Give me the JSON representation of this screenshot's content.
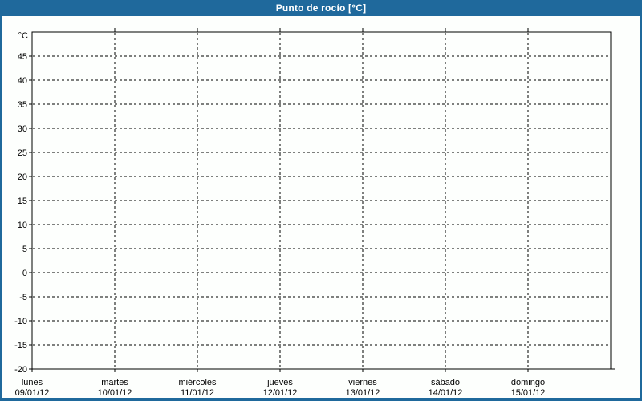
{
  "window": {
    "background": "#fdfffd",
    "border_color": "#1f699c"
  },
  "title_bar": {
    "label": "Punto de rocío [°C]",
    "background": "#1f699c",
    "text_color": "#ffffff"
  },
  "chart_data": {
    "type": "line",
    "title": "Punto de rocío [°C]",
    "unit_label": "°C",
    "ylim": [
      -20,
      50
    ],
    "ytick_step": 5,
    "yticks": [
      45,
      40,
      35,
      30,
      25,
      20,
      15,
      10,
      5,
      0,
      -5,
      -10,
      -15,
      -20
    ],
    "x_categories": [
      {
        "day": "lunes",
        "date": "09/01/12"
      },
      {
        "day": "martes",
        "date": "10/01/12"
      },
      {
        "day": "miércoles",
        "date": "11/01/12"
      },
      {
        "day": "jueves",
        "date": "12/01/12"
      },
      {
        "day": "viernes",
        "date": "13/01/12"
      },
      {
        "day": "sábado",
        "date": "14/01/12"
      },
      {
        "day": "domingo",
        "date": "15/01/12"
      }
    ],
    "series": [],
    "grid": "dashed",
    "axis_color": "#000000",
    "grid_color": "#000000",
    "label_color": "#000000"
  }
}
